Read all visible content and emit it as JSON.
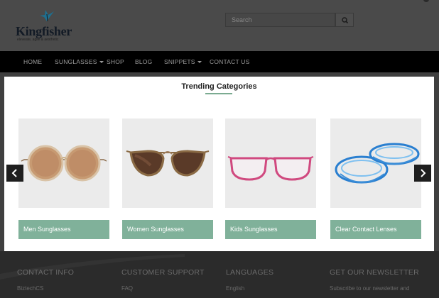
{
  "header": {
    "logo_text": "Kingfisher",
    "logo_tagline": "eleveate, agile & aesthetic",
    "search_placeholder": "Search"
  },
  "nav": {
    "items": [
      {
        "label": "HOME"
      },
      {
        "label": "SUNGLASSES"
      },
      {
        "label": "SHOP"
      },
      {
        "label": "BLOG"
      },
      {
        "label": "SNIPPETS"
      },
      {
        "label": "CONTACT US"
      }
    ]
  },
  "modal": {
    "title": "Trending Categories",
    "categories": [
      {
        "label": "Men Sunglasses",
        "icon": "round-sunglasses-icon"
      },
      {
        "label": "Women Sunglasses",
        "icon": "cat-eye-sunglasses-icon"
      },
      {
        "label": "Kids Sunglasses",
        "icon": "pink-glasses-icon"
      },
      {
        "label": "Clear Contact Lenses",
        "icon": "contact-lens-icon"
      }
    ],
    "accent_color": "#80b19a"
  },
  "footer": {
    "columns": [
      {
        "heading": "CONTACT INFO",
        "item": "BiztechCS"
      },
      {
        "heading": "CUSTOMER SUPPORT",
        "item": "FAQ"
      },
      {
        "heading": "LANGUAGES",
        "item": "English"
      },
      {
        "heading": "GET OUR NEWSLETTER",
        "item": "Subscribe to our newsletter and"
      }
    ]
  }
}
